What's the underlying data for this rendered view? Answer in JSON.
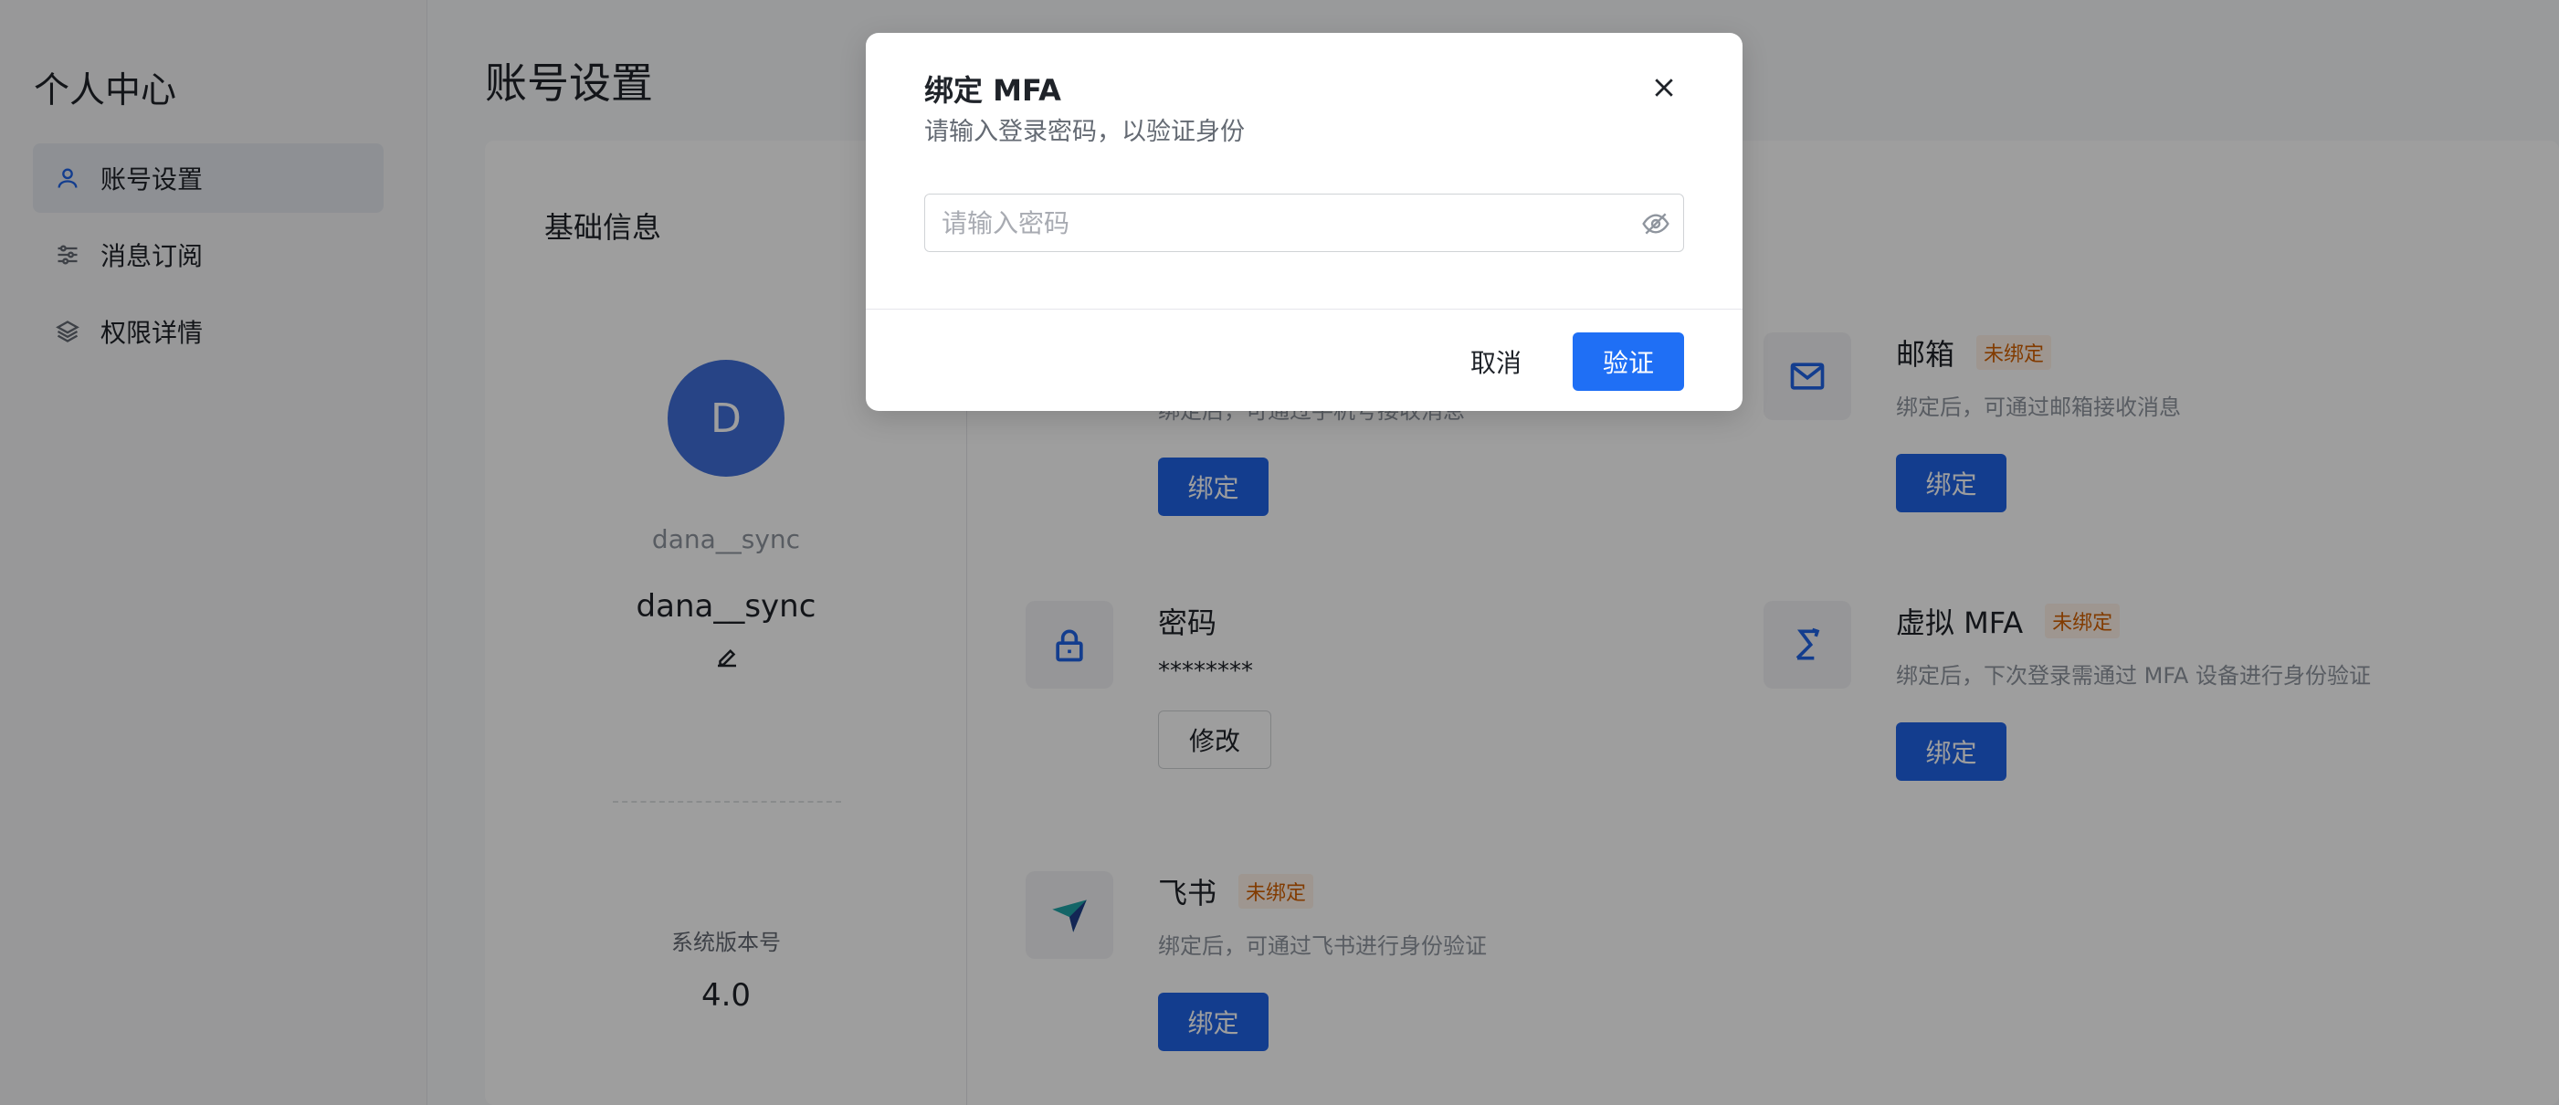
{
  "sidebar": {
    "title": "个人中心",
    "items": [
      {
        "label": "账号设置"
      },
      {
        "label": "消息订阅"
      },
      {
        "label": "权限详情"
      }
    ]
  },
  "page": {
    "title": "账号设置"
  },
  "basic": {
    "section_title": "基础信息",
    "avatar_letter": "D",
    "username_muted": "dana__sync",
    "username": "dana__sync",
    "version_label": "系统版本号",
    "version_value": "4.0"
  },
  "bindings": {
    "first": {
      "desc": "绑定后，可通过手机号接收消息",
      "button": "绑定"
    },
    "email": {
      "name": "邮箱",
      "badge": "未绑定",
      "desc": "绑定后，可通过邮箱接收消息",
      "button": "绑定"
    },
    "password": {
      "name": "密码",
      "value": "********",
      "button": "修改"
    },
    "mfa": {
      "name": "虚拟 MFA",
      "badge": "未绑定",
      "desc": "绑定后，下次登录需通过 MFA 设备进行身份验证",
      "button": "绑定"
    },
    "feishu": {
      "name": "飞书",
      "badge": "未绑定",
      "desc": "绑定后，可通过飞书进行身份验证",
      "button": "绑定"
    }
  },
  "modal": {
    "title": "绑定 MFA",
    "subtitle": "请输入登录密码，以验证身份",
    "password_placeholder": "请输入密码",
    "cancel_label": "取消",
    "verify_label": "验证"
  },
  "colors": {
    "primary": "#1f63e6",
    "badge_text": "#d25f00",
    "badge_bg": "#fff3e8",
    "overlay": "rgba(0,0,0,0.38)"
  }
}
